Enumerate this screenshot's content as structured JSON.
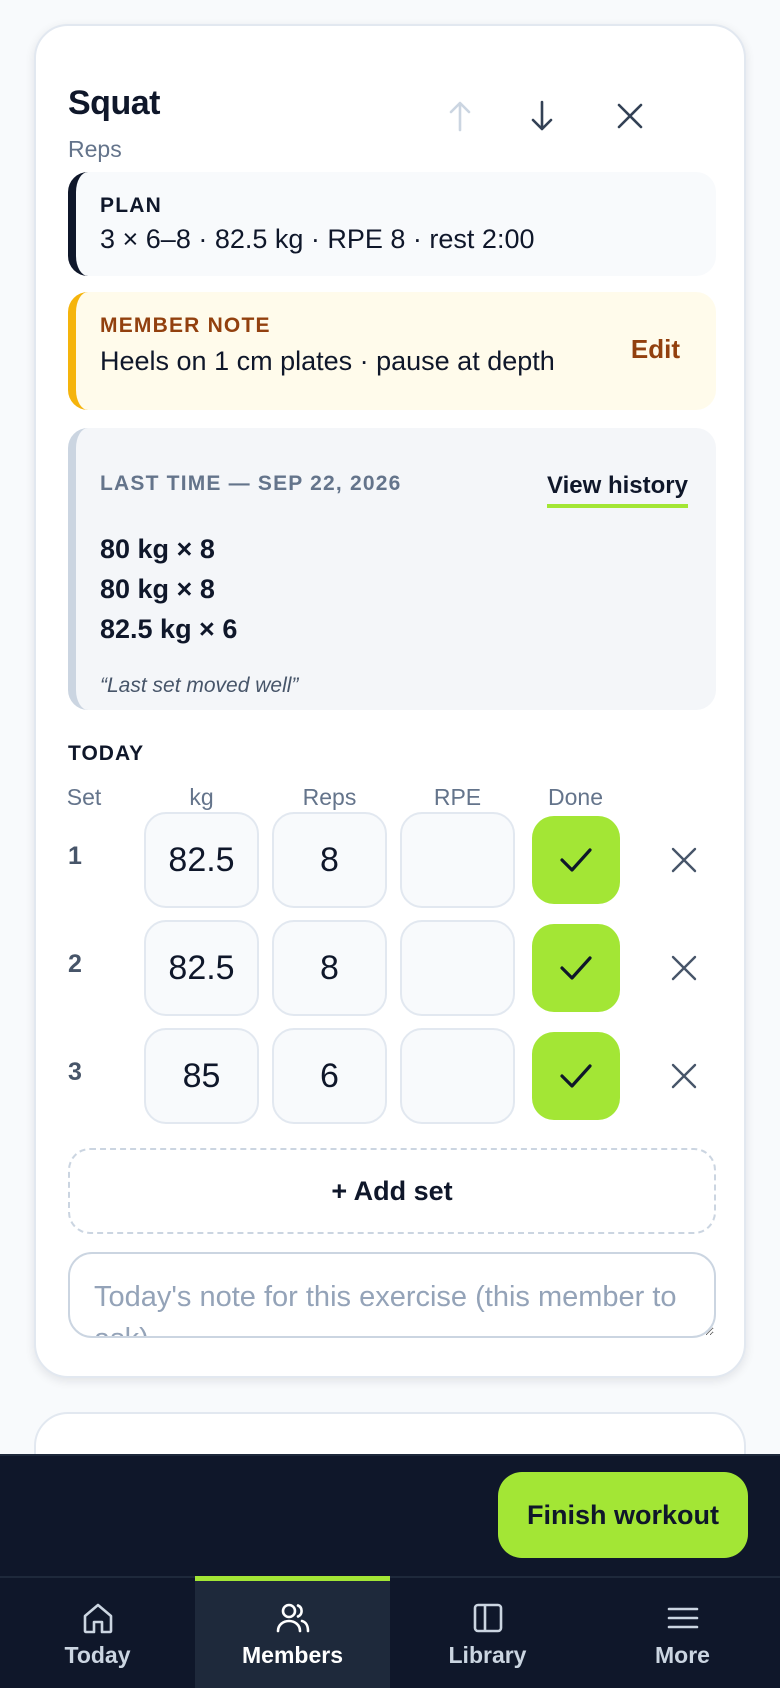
{
  "exercise": {
    "name": "Squat",
    "type": "Reps",
    "move_up_icon": "arrow-up-icon",
    "move_down_icon": "arrow-down-icon",
    "remove_icon": "close-icon"
  },
  "plan": {
    "label": "PLAN",
    "text": "3 × 6–8 · 82.5 kg · RPE 8 · rest 2:00"
  },
  "member_note": {
    "label": "MEMBER NOTE",
    "text": "Heels on 1 cm plates · pause at depth",
    "edit_label": "Edit"
  },
  "last_time": {
    "label": "LAST TIME — SEP 22, 2026",
    "history_label": "View history",
    "sets": [
      "80 kg × 8",
      "80 kg × 8",
      "82.5 kg × 6"
    ],
    "note": "“Last set moved well”"
  },
  "today": {
    "label": "TODAY",
    "columns": {
      "set": "Set",
      "kg": "kg",
      "reps": "Reps",
      "rpe": "RPE",
      "done": "Done"
    },
    "sets": [
      {
        "num": "1",
        "kg": "82.5",
        "reps": "8",
        "rpe": "",
        "done": true
      },
      {
        "num": "2",
        "kg": "82.5",
        "reps": "8",
        "rpe": "",
        "done": true
      },
      {
        "num": "3",
        "kg": "85",
        "reps": "6",
        "rpe": "",
        "done": true
      }
    ],
    "add_set_label": "+ Add set",
    "note_placeholder": "Today's note for this exercise (this member to ask)"
  },
  "finish_label": "Finish workout",
  "tabs": [
    {
      "label": "Today",
      "icon": "home-icon",
      "active": false
    },
    {
      "label": "Members",
      "icon": "users-icon",
      "active": true
    },
    {
      "label": "Library",
      "icon": "book-icon",
      "active": false
    },
    {
      "label": "More",
      "icon": "menu-icon",
      "active": false
    }
  ],
  "colors": {
    "accent": "#a3e635",
    "dark": "#0f172a",
    "note_accent": "#f5b40c"
  }
}
